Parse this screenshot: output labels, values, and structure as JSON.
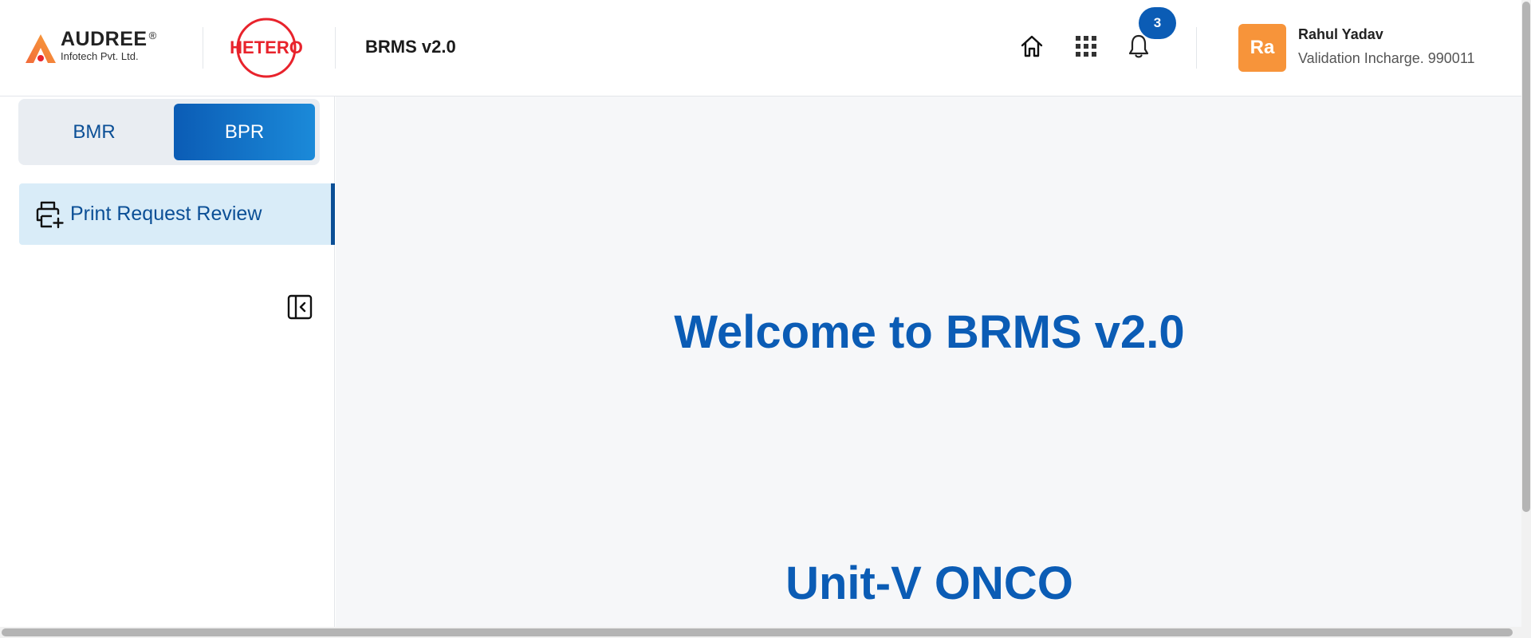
{
  "header": {
    "audree_logo": {
      "name": "AUDREE",
      "registered_mark": "®",
      "subtitle": "Infotech Pvt. Ltd.",
      "icon": "audree-triangle-logo"
    },
    "client_logo": {
      "text": "HETERO",
      "color": "#e8232c"
    },
    "app_title": "BRMS v2.0",
    "icons": [
      "home-icon",
      "apps-grid-icon",
      "bell-icon"
    ],
    "notification_count": "3",
    "user": {
      "avatar_initials": "Ra",
      "name": "Rahul Yadav",
      "role": "Validation Incharge. 990011"
    }
  },
  "sidebar": {
    "segments": [
      {
        "label": "BMR",
        "active": false
      },
      {
        "label": "BPR",
        "active": true
      }
    ],
    "nav_items": [
      {
        "label": "Print Request Review",
        "icon": "printer-plus-icon",
        "active": true
      }
    ],
    "collapse_icon": "sidebar-collapse-icon"
  },
  "main": {
    "welcome_text": "Welcome to BRMS v2.0",
    "unit_text": "Unit-V ONCO"
  },
  "colors": {
    "primary": "#0b5cb5",
    "nav_active_bg": "#d9ecf8",
    "avatar_bg": "#f7943a",
    "hetero_red": "#e8232c",
    "main_bg": "#f6f7f9"
  }
}
